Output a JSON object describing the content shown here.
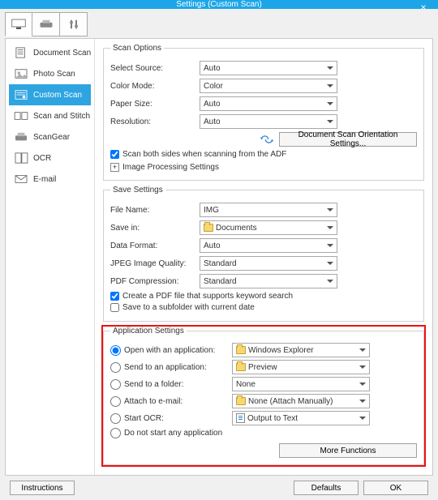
{
  "title": "Settings (Custom Scan)",
  "topTabs": [
    "monitor-icon",
    "scanner-icon",
    "sliders-icon"
  ],
  "sidebar": {
    "items": [
      {
        "label": "Document Scan"
      },
      {
        "label": "Photo Scan"
      },
      {
        "label": "Custom Scan"
      },
      {
        "label": "Scan and Stitch"
      },
      {
        "label": "ScanGear"
      },
      {
        "label": "OCR"
      },
      {
        "label": "E-mail"
      }
    ]
  },
  "scanOptions": {
    "legend": "Scan Options",
    "selectSourceLbl": "Select Source:",
    "selectSource": "Auto",
    "colorModeLbl": "Color Mode:",
    "colorMode": "Color",
    "paperSizeLbl": "Paper Size:",
    "paperSize": "Auto",
    "resolutionLbl": "Resolution:",
    "resolution": "Auto",
    "orientBtn": "Document Scan Orientation Settings...",
    "scanBoth": "Scan both sides when scanning from the ADF",
    "imgProc": "Image Processing Settings"
  },
  "saveSettings": {
    "legend": "Save Settings",
    "fileNameLbl": "File Name:",
    "fileName": "IMG",
    "saveInLbl": "Save in:",
    "saveIn": "Documents",
    "dataFormatLbl": "Data Format:",
    "dataFormat": "Auto",
    "jpegLbl": "JPEG Image Quality:",
    "jpeg": "Standard",
    "pdfLbl": "PDF Compression:",
    "pdf": "Standard",
    "createPdf": "Create a PDF file that supports keyword search",
    "subfolder": "Save to a subfolder with current date"
  },
  "appSettings": {
    "legend": "Application Settings",
    "openWith": "Open with an application:",
    "openWithVal": "Windows Explorer",
    "sendApp": "Send to an application:",
    "sendAppVal": "Preview",
    "sendFolder": "Send to a folder:",
    "sendFolderVal": "None",
    "attach": "Attach to e-mail:",
    "attachVal": "None (Attach Manually)",
    "ocr": "Start OCR:",
    "ocrVal": "Output to Text",
    "noStart": "Do not start any application",
    "moreFn": "More Functions"
  },
  "footer": {
    "instructions": "Instructions",
    "defaults": "Defaults",
    "ok": "OK"
  }
}
